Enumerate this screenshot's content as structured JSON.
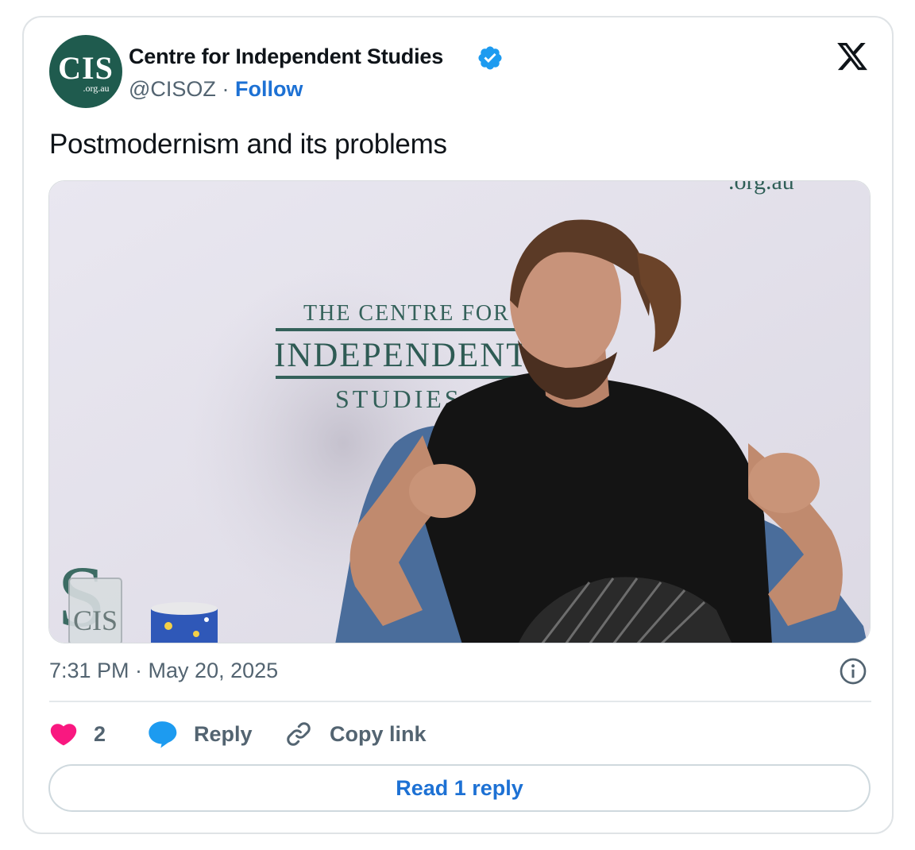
{
  "author": {
    "avatar_main": "CIS",
    "avatar_sub": ".org.au",
    "name": "Centre for Independent Studies",
    "handle": "@CISOZ",
    "separator": "·",
    "follow_label": "Follow",
    "verified_icon": "verified-badge-icon"
  },
  "tweet": {
    "text": "Postmodernism and its problems"
  },
  "media": {
    "backdrop_line1": "THE CENTRE FOR",
    "backdrop_line2": "INDEPENDENT",
    "backdrop_line3": "STUDIES",
    "backdrop_top": ".org.au",
    "backdrop_letter": "S",
    "glass_text": "CIS"
  },
  "meta": {
    "timestamp": "7:31 PM · May 20, 2025",
    "info_icon": "info-icon"
  },
  "actions": {
    "like_count": "2",
    "reply_label": "Reply",
    "copy_link_label": "Copy link"
  },
  "footer": {
    "read_reply_label": "Read 1 reply"
  },
  "colors": {
    "accent": "#1d71d4",
    "like": "#f91880",
    "reply_icon": "#1d9bf0",
    "brand": "#1f5b4e"
  }
}
